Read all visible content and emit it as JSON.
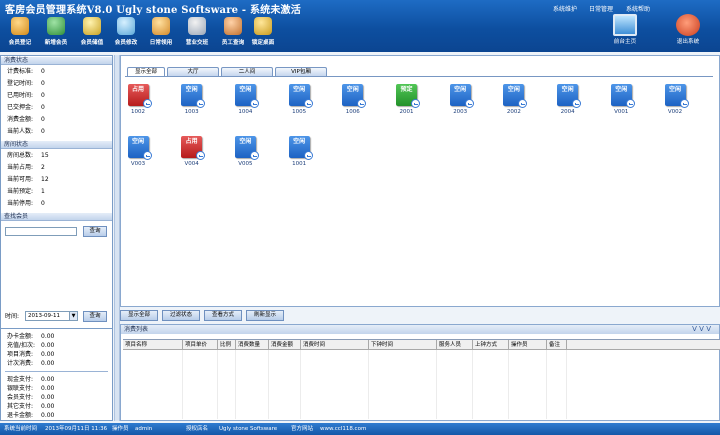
{
  "header": {
    "title": "客房会员管理系统V8.0 Ugly stone Softsware - 系统未激活",
    "links": [
      "系统维护",
      "日常管理",
      "系统帮助"
    ],
    "toolbar": [
      "会员登记",
      "新增会员",
      "会员储值",
      "会员修改",
      "日常领用",
      "营业交班",
      "员工查询",
      "锁定桌面"
    ],
    "big_buttons": [
      "前台主页",
      "退出系统"
    ]
  },
  "left_panel": {
    "consumption_title": "消费状态",
    "consumption": [
      {
        "k": "计费标准:",
        "v": "0"
      },
      {
        "k": "登记时间:",
        "v": "0"
      },
      {
        "k": "已用时间:",
        "v": "0"
      },
      {
        "k": "已交押金:",
        "v": "0"
      },
      {
        "k": "消费金额:",
        "v": "0"
      },
      {
        "k": "当前人数:",
        "v": "0"
      }
    ],
    "room_title": "房间状态",
    "rooms": [
      {
        "k": "房间总数:",
        "v": "15"
      },
      {
        "k": "当前占用:",
        "v": "2"
      },
      {
        "k": "当前可用:",
        "v": "12"
      },
      {
        "k": "当前预定:",
        "v": "1"
      },
      {
        "k": "当前停用:",
        "v": "0"
      }
    ],
    "member_title": "查找会员",
    "search_value": "",
    "search_button": "查询",
    "time_label": "时间:",
    "date_value": "2013-09-11",
    "date_query_button": "查询"
  },
  "stats": [
    {
      "k": "办卡金额:",
      "v": "0.00"
    },
    {
      "k": "充值/扣次:",
      "v": "0.00"
    },
    {
      "k": "项目消费:",
      "v": "0.00"
    },
    {
      "k": "计次消费:",
      "v": "0.00"
    },
    {
      "k": "现金支付:",
      "v": "0.00"
    },
    {
      "k": "银联支付:",
      "v": "0.00"
    },
    {
      "k": "会员支付:",
      "v": "0.00"
    },
    {
      "k": "其它支付:",
      "v": "0.00"
    },
    {
      "k": "退卡金额:",
      "v": "0.00"
    }
  ],
  "tabs": [
    "显示全部",
    "大厅",
    "二人间",
    "VIP包厢"
  ],
  "rooms": [
    {
      "status": "占用",
      "name": "1002",
      "type": "busy"
    },
    {
      "status": "空闲",
      "name": "1003",
      "type": "free"
    },
    {
      "status": "空闲",
      "name": "1004",
      "type": "free"
    },
    {
      "status": "空闲",
      "name": "1005",
      "type": "free"
    },
    {
      "status": "空闲",
      "name": "1006",
      "type": "free"
    },
    {
      "status": "预定",
      "name": "2001",
      "type": "res"
    },
    {
      "status": "空闲",
      "name": "2003",
      "type": "free"
    },
    {
      "status": "空闲",
      "name": "2002",
      "type": "free"
    },
    {
      "status": "空闲",
      "name": "2004",
      "type": "free"
    },
    {
      "status": "空闲",
      "name": "V001",
      "type": "free"
    },
    {
      "status": "空闲",
      "name": "V002",
      "type": "free"
    },
    {
      "status": "空闲",
      "name": "V003",
      "type": "free"
    },
    {
      "status": "占用",
      "name": "V004",
      "type": "busy"
    },
    {
      "status": "空闲",
      "name": "V005",
      "type": "free"
    },
    {
      "status": "空闲",
      "name": "1001",
      "type": "free"
    }
  ],
  "actions": [
    "显示全部",
    "过滤状态",
    "查看方式",
    "刷新显示"
  ],
  "consumption_list": {
    "title": "消费列表",
    "chevrons": "V V V",
    "columns": [
      "项目名称",
      "项目单价",
      "比例",
      "消费数量",
      "消费金额",
      "消费时间",
      "下钟时间",
      "服务人员",
      "上钟方式",
      "操作员",
      "备注"
    ]
  },
  "statusbar": {
    "time_label": "系统当前时间",
    "time_value": "2013年09月11日 11:36",
    "operator_label": "操作员",
    "operator": "admin",
    "licensee_label": "授权店名",
    "licensee": "Ugly stone Softsware",
    "site_label": "官方网站",
    "site": "www.ccl118.com"
  },
  "colors": {
    "accent": "#1457a8",
    "free": "#1d62c3",
    "busy": "#b61c1c",
    "reserved": "#23912a"
  }
}
